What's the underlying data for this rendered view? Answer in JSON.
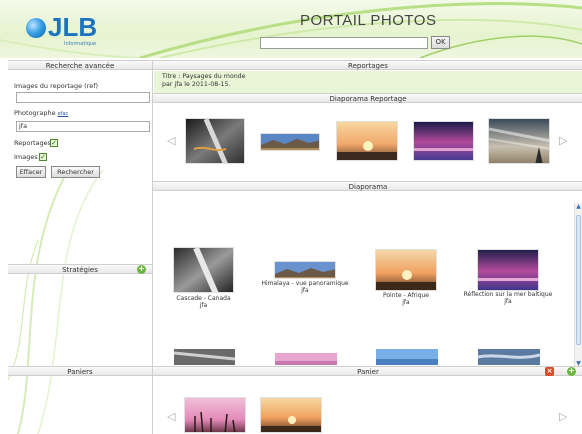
{
  "header": {
    "brand": "JLB",
    "brand_sub": "Informatique",
    "title": "PORTAIL PHOTOS",
    "search": {
      "value": "",
      "placeholder": ""
    },
    "ok_label": "OK"
  },
  "search_panel": {
    "title": "Recherche avancée",
    "ref_label": "Images du reportage (ref)",
    "ref_value": "",
    "photographer_label": "Photographe",
    "photographer_link": "efac",
    "photographer_value": "jfa",
    "reportages_label": "Reportages",
    "images_label": "Images",
    "clear_label": "Effacer",
    "search_label": "Rechercher"
  },
  "strategies_panel": {
    "title": "Stratégies"
  },
  "baskets_panel": {
    "title": "Paniers"
  },
  "reportages": {
    "title": "Reportages",
    "info_line1": "Titre : Paysages du monde",
    "info_line2": "par jfa le 2011-08-15.",
    "slideshow_title": "Diaporama Reportage"
  },
  "diaporama": {
    "title": "Diaporama",
    "items": [
      {
        "caption": "Cascade - Canada",
        "author": "jfa"
      },
      {
        "caption": "Himalaya - vue panoramique",
        "author": "jfa"
      },
      {
        "caption": "Pointe - Afrique",
        "author": "jfa"
      },
      {
        "caption": "Réflection sur la mer baltique",
        "author": "jfa"
      }
    ]
  },
  "panier": {
    "title": "Panier"
  },
  "icons": {
    "prev": "chevron-left-icon",
    "next": "chevron-right-icon",
    "add": "plus-icon",
    "delete": "close-icon"
  },
  "colors": {
    "accent_green": "#6bb63c",
    "brand_blue": "#1a74c0",
    "info_bg": "#e8f5d6"
  }
}
